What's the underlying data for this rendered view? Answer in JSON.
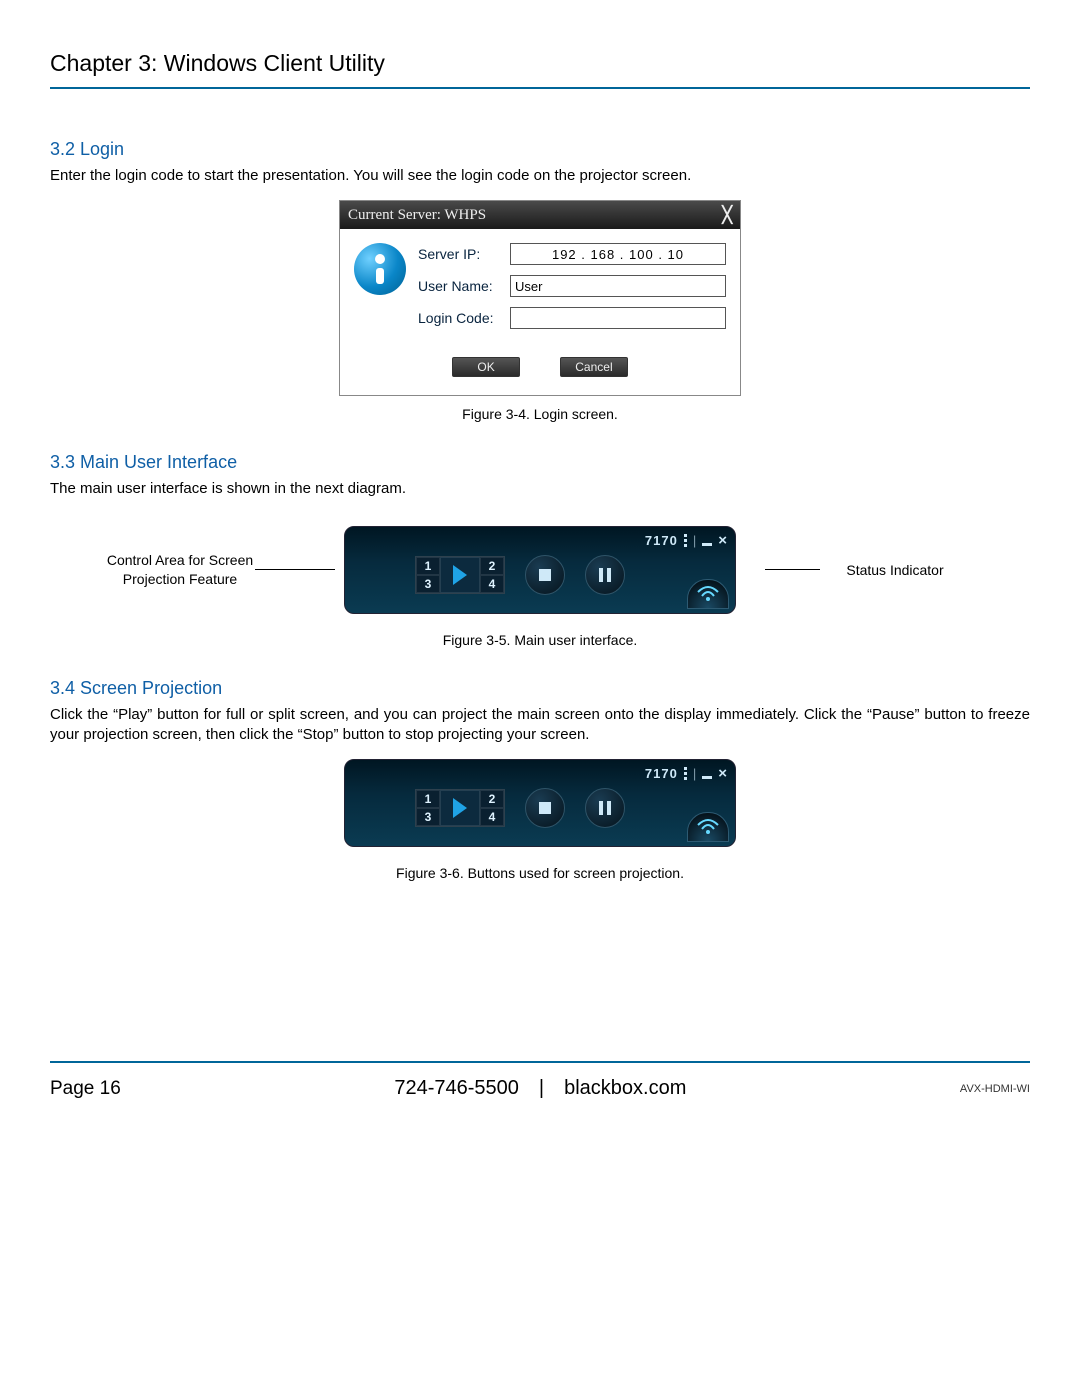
{
  "chapter_title": "Chapter 3: Windows Client Utility",
  "sections": {
    "login": {
      "heading": "3.2 Login",
      "text": "Enter the login code to start the presentation. You will see the login code on the projector screen.",
      "caption": "Figure 3-4. Login screen."
    },
    "main_ui": {
      "heading": "3.3 Main User Interface",
      "text": "The main user interface is shown in the next diagram.",
      "caption": "Figure 3-5. Main user interface.",
      "label_left": "Control Area for Screen Projection Feature",
      "label_right": "Status Indicator"
    },
    "projection": {
      "heading": "3.4 Screen Projection",
      "text": "Click the “Play” button for full or split screen, and you can project the main screen onto the display immediately. Click the “Pause” button to freeze your projection screen, then click the “Stop” button to stop projecting your screen.",
      "caption": "Figure 3-6. Buttons used for screen projection."
    }
  },
  "login_dialog": {
    "title": "Current Server: WHPS",
    "fields": {
      "server_ip_label": "Server IP:",
      "server_ip_value": "192 . 168 . 100 . 10",
      "user_name_label": "User Name:",
      "user_name_value": "User",
      "login_code_label": "Login Code:",
      "login_code_value": ""
    },
    "buttons": {
      "ok": "OK",
      "cancel": "Cancel"
    }
  },
  "control_bar": {
    "status_number": "7170",
    "quadrants": {
      "q1": "1",
      "q2": "2",
      "q3": "3",
      "q4": "4"
    }
  },
  "footer": {
    "page_label": "Page 16",
    "center": "724-746-5500 | blackbox.com",
    "model": "AVX-HDMI-WI"
  }
}
